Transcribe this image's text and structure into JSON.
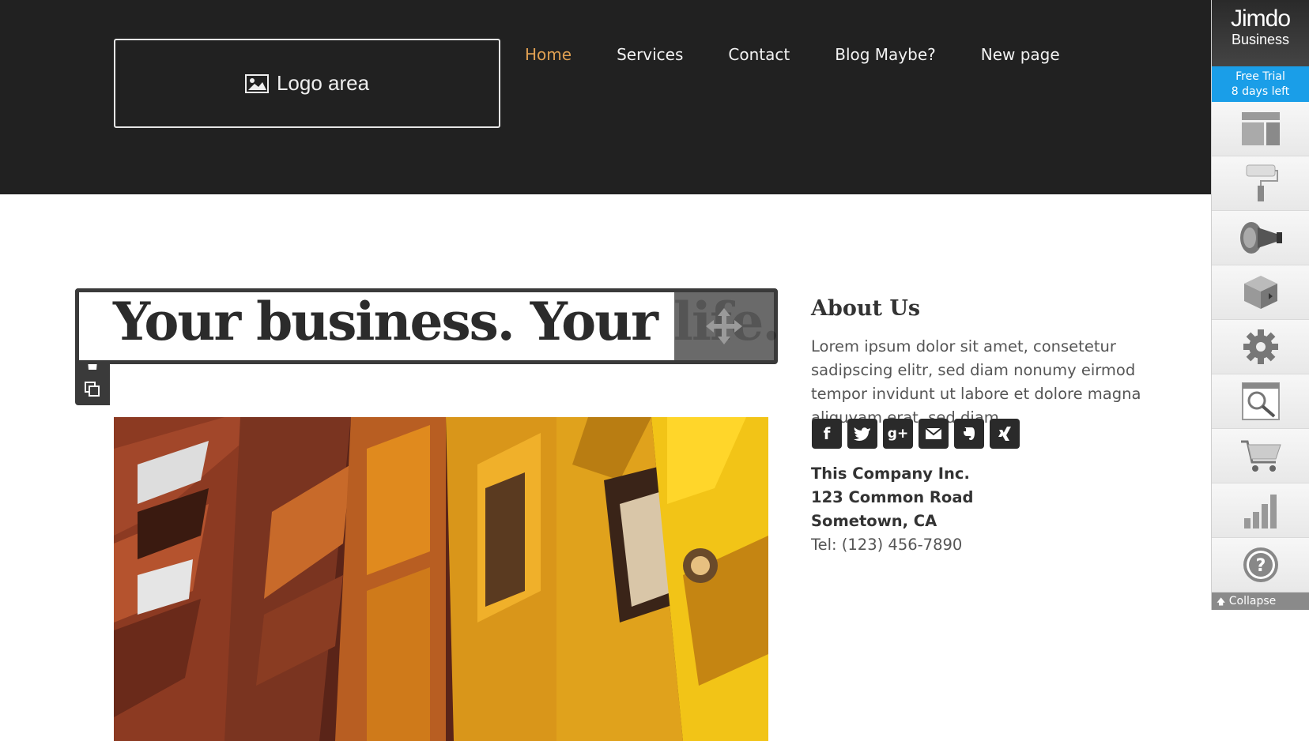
{
  "header": {
    "logo_label": "Logo area",
    "nav": [
      {
        "label": "Home",
        "active": true
      },
      {
        "label": "Services",
        "active": false
      },
      {
        "label": "Contact",
        "active": false
      },
      {
        "label": "Blog Maybe?",
        "active": false
      },
      {
        "label": "New page",
        "active": false
      }
    ]
  },
  "headline": "Your business. Your life.",
  "about": {
    "title": "About Us",
    "text": "Lorem ipsum dolor sit amet, consetetur sadipscing elitr, sed diam nonumy eirmod tempor invidunt ut labore et dolore magna aliquyam erat, sed diam.",
    "social": [
      "facebook-icon",
      "twitter-icon",
      "google-plus-icon",
      "email-icon",
      "evernote-icon",
      "xing-icon"
    ],
    "company": "This Company Inc.",
    "street": "123 Common Road",
    "city": "Sometown, CA",
    "tel": "Tel: (123) 456-7890"
  },
  "sidebar": {
    "brand_line1": "Jimdo",
    "brand_line2": "Business",
    "trial_line1": "Free Trial",
    "trial_line2": "8 days left",
    "items": [
      "layout-icon",
      "style-icon",
      "marketing-icon",
      "store-icon",
      "settings-icon",
      "seo-icon",
      "cart-icon",
      "statistics-icon",
      "help-icon"
    ],
    "collapse": "Collapse"
  },
  "colors": {
    "header_bg": "#212121",
    "nav_active": "#e0a052",
    "trial_bg": "#1a9ee8"
  }
}
